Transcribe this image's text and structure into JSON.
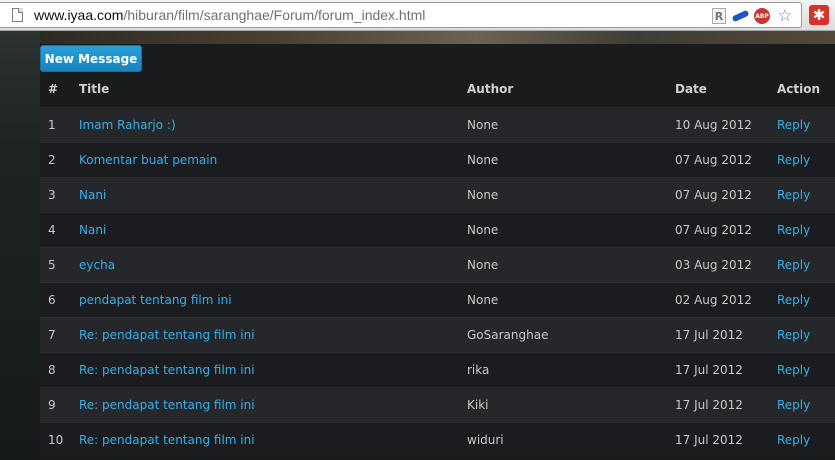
{
  "browser": {
    "url_host": "www.iyaa.com",
    "url_path": "/hiburan/film/saranghae/Forum/forum_index.html",
    "ext_r_label": "R",
    "ext_abp_label": "ABP",
    "star_glyph": "☆",
    "ext_red_glyph": "✱"
  },
  "forum": {
    "new_message_label": "New Message",
    "columns": [
      "#",
      "Title",
      "Author",
      "Date",
      "Action"
    ],
    "rows": [
      {
        "num": "1",
        "title": "Imam Raharjo :)",
        "author": "None",
        "date": "10 Aug 2012",
        "action": "Reply"
      },
      {
        "num": "2",
        "title": "Komentar buat pemain",
        "author": "None",
        "date": "07 Aug 2012",
        "action": "Reply"
      },
      {
        "num": "3",
        "title": "Nani",
        "author": "None",
        "date": "07 Aug 2012",
        "action": "Reply"
      },
      {
        "num": "4",
        "title": "Nani",
        "author": "None",
        "date": "07 Aug 2012",
        "action": "Reply"
      },
      {
        "num": "5",
        "title": "eycha",
        "author": "None",
        "date": "03 Aug 2012",
        "action": "Reply"
      },
      {
        "num": "6",
        "title": "pendapat tentang film ini",
        "author": "None",
        "date": "02 Aug 2012",
        "action": "Reply"
      },
      {
        "num": "7",
        "title": "Re: pendapat tentang film ini",
        "author": "GoSaranghae",
        "date": "17 Jul 2012",
        "action": "Reply"
      },
      {
        "num": "8",
        "title": "Re: pendapat tentang film ini",
        "author": "rika",
        "date": "17 Jul 2012",
        "action": "Reply"
      },
      {
        "num": "9",
        "title": "Re: pendapat tentang film ini",
        "author": "Kiki",
        "date": "17 Jul 2012",
        "action": "Reply"
      },
      {
        "num": "10",
        "title": "Re: pendapat tentang film ini",
        "author": "widuri",
        "date": "17 Jul 2012",
        "action": "Reply"
      }
    ]
  },
  "colors": {
    "link": "#3aaee6",
    "button": "#1b8ac6"
  }
}
